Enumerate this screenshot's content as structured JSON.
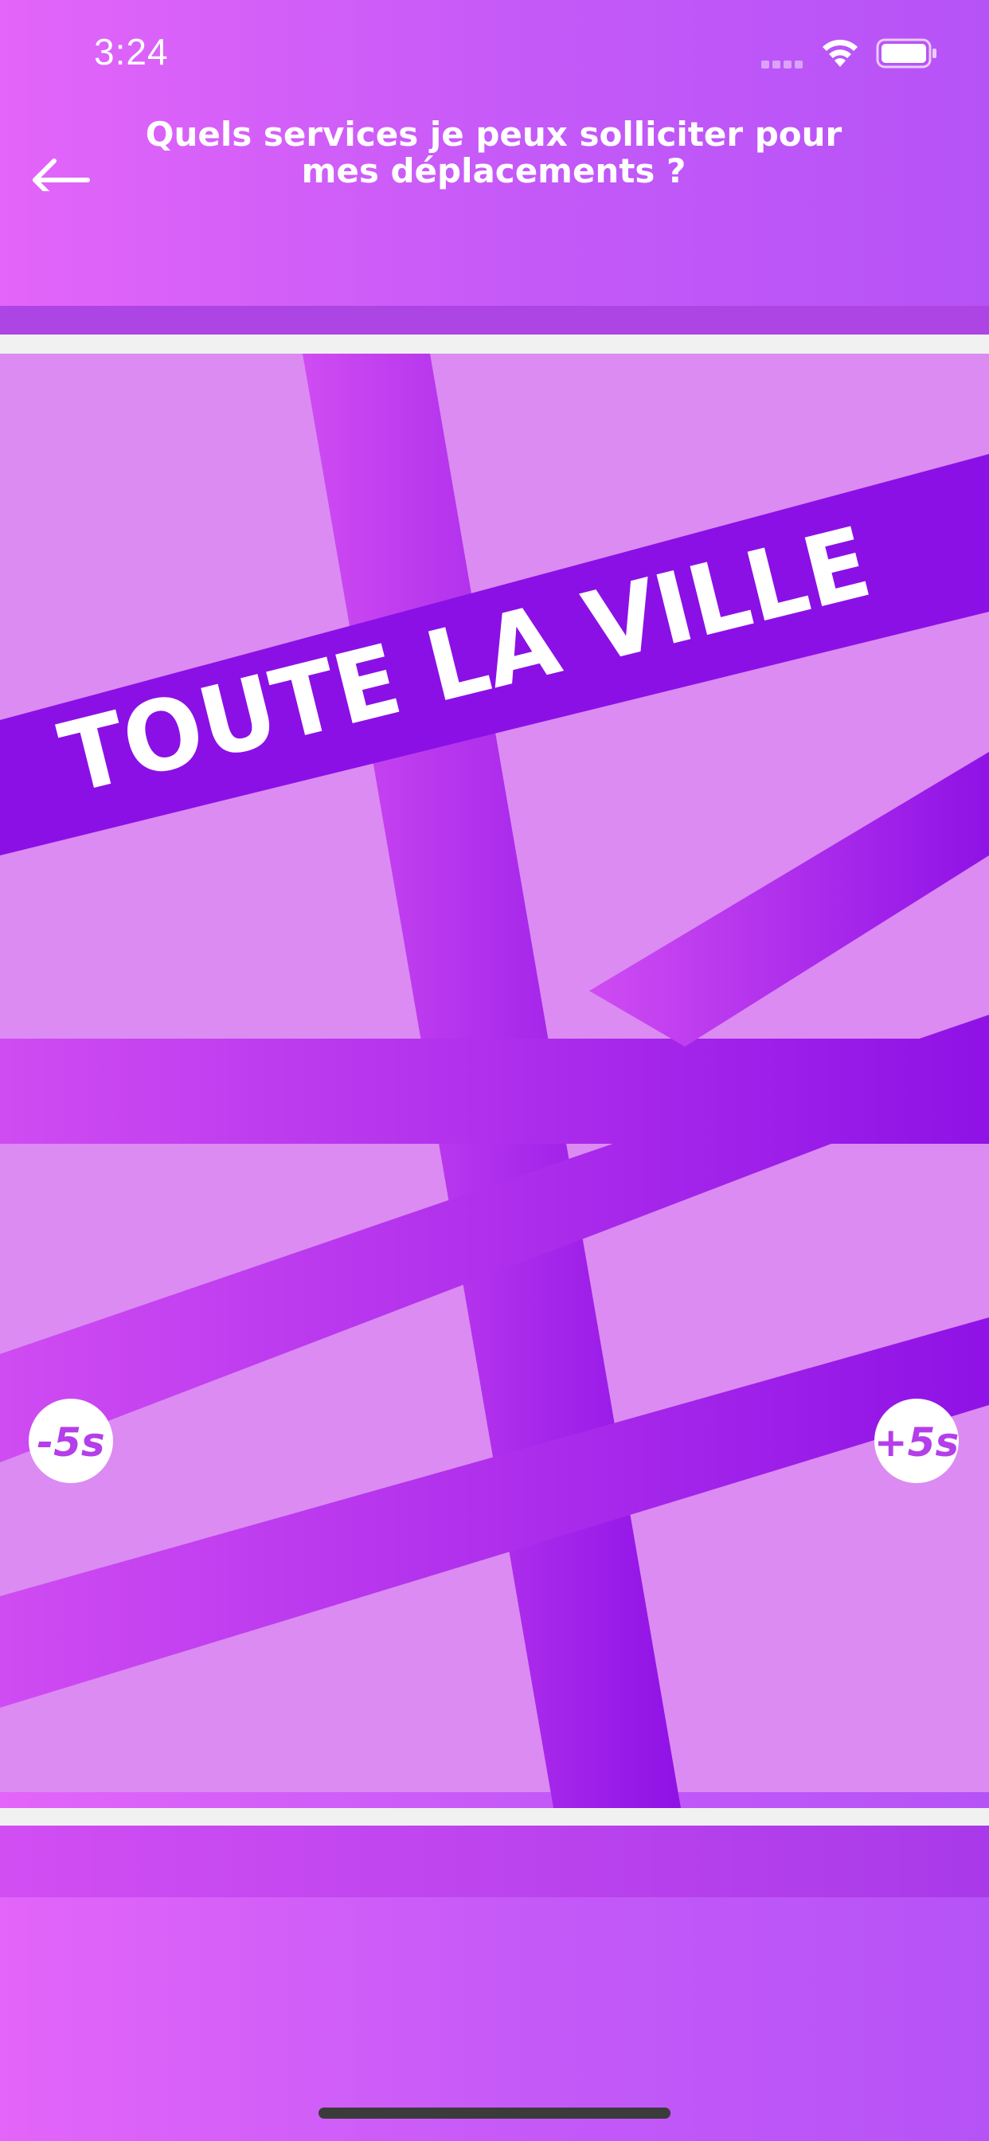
{
  "status_bar": {
    "time": "3:24"
  },
  "header": {
    "title": "Quels services je peux solliciter pour mes déplacements ?"
  },
  "video": {
    "banner_text": "TOUTE LA VILLE",
    "seek_back_label": "-5s",
    "seek_forward_label": "+5s"
  },
  "colors": {
    "background_start": "#e365f9",
    "background_end": "#b653f7",
    "video_background": "#dc8bf2",
    "road_color": "#a626ec",
    "banner_color": "#8b10e6"
  },
  "icons": {
    "back": "arrow-left-icon",
    "signal": "cellular-signal-icon",
    "wifi": "wifi-icon",
    "battery": "battery-icon"
  }
}
